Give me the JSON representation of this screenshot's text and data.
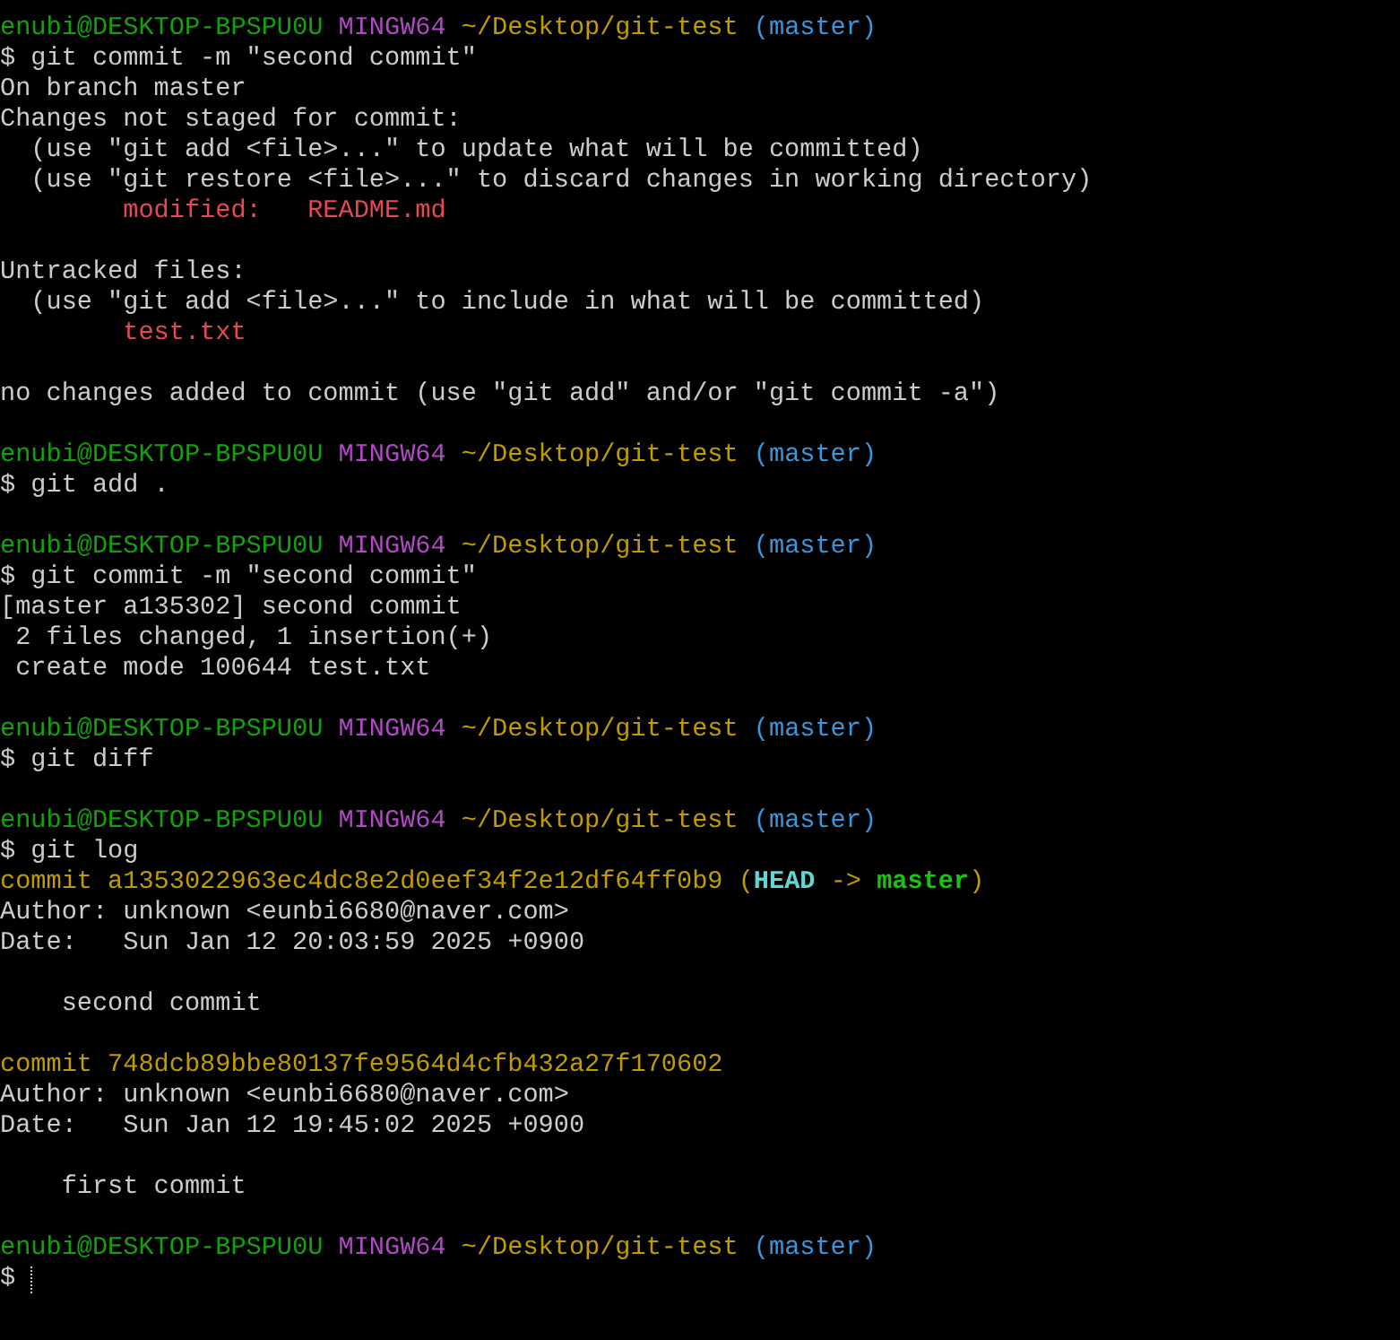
{
  "blocks": [
    {
      "lines": [
        {
          "segments": [
            {
              "text": "enubi@DESKTOP-BPSPU0U",
              "color": "#13a10e"
            },
            {
              "text": " MINGW64",
              "color": "#b148c6"
            },
            {
              "text": " ~/Desktop/git-test",
              "color": "#c19c00"
            },
            {
              "text": " (master)",
              "color": "#3a96dd"
            }
          ]
        },
        {
          "segments": [
            {
              "text": "$ git commit -m \"second commit\"",
              "color": "#cccccc"
            }
          ]
        },
        {
          "segments": [
            {
              "text": "On branch master",
              "color": "#cccccc"
            }
          ]
        },
        {
          "segments": [
            {
              "text": "Changes not staged for commit:",
              "color": "#cccccc"
            }
          ]
        },
        {
          "segments": [
            {
              "text": "  (use \"git add <file>...\" to update what will be committed)",
              "color": "#cccccc"
            }
          ]
        },
        {
          "segments": [
            {
              "text": "  (use \"git restore <file>...\" to discard changes in working directory)",
              "color": "#cccccc"
            }
          ]
        },
        {
          "segments": [
            {
              "text": "        modified:   README.md",
              "color": "#e74856"
            }
          ]
        }
      ]
    },
    {
      "lines": [
        {
          "segments": [
            {
              "text": "Untracked files:",
              "color": "#cccccc"
            }
          ]
        },
        {
          "segments": [
            {
              "text": "  (use \"git add <file>...\" to include in what will be committed)",
              "color": "#cccccc"
            }
          ]
        },
        {
          "segments": [
            {
              "text": "        test.txt",
              "color": "#e74856"
            }
          ]
        }
      ]
    },
    {
      "lines": [
        {
          "segments": [
            {
              "text": "no changes added to commit (use \"git add\" and/or \"git commit -a\")",
              "color": "#cccccc"
            }
          ]
        }
      ]
    },
    {
      "lines": [
        {
          "segments": [
            {
              "text": "enubi@DESKTOP-BPSPU0U",
              "color": "#13a10e"
            },
            {
              "text": " MINGW64",
              "color": "#b148c6"
            },
            {
              "text": " ~/Desktop/git-test",
              "color": "#c19c00"
            },
            {
              "text": " (master)",
              "color": "#3a96dd"
            }
          ]
        },
        {
          "segments": [
            {
              "text": "$ git add .",
              "color": "#cccccc"
            }
          ]
        }
      ]
    },
    {
      "lines": [
        {
          "segments": [
            {
              "text": "enubi@DESKTOP-BPSPU0U",
              "color": "#13a10e"
            },
            {
              "text": " MINGW64",
              "color": "#b148c6"
            },
            {
              "text": " ~/Desktop/git-test",
              "color": "#c19c00"
            },
            {
              "text": " (master)",
              "color": "#3a96dd"
            }
          ]
        },
        {
          "segments": [
            {
              "text": "$ git commit -m \"second commit\"",
              "color": "#cccccc"
            }
          ]
        },
        {
          "segments": [
            {
              "text": "[master a135302] second commit",
              "color": "#cccccc"
            }
          ]
        },
        {
          "segments": [
            {
              "text": " 2 files changed, 1 insertion(+)",
              "color": "#cccccc"
            }
          ]
        },
        {
          "segments": [
            {
              "text": " create mode 100644 test.txt",
              "color": "#cccccc"
            }
          ]
        }
      ]
    },
    {
      "lines": [
        {
          "segments": [
            {
              "text": "enubi@DESKTOP-BPSPU0U",
              "color": "#13a10e"
            },
            {
              "text": " MINGW64",
              "color": "#b148c6"
            },
            {
              "text": " ~/Desktop/git-test",
              "color": "#c19c00"
            },
            {
              "text": " (master)",
              "color": "#3a96dd"
            }
          ]
        },
        {
          "segments": [
            {
              "text": "$ git diff",
              "color": "#cccccc"
            }
          ]
        }
      ]
    },
    {
      "lines": [
        {
          "segments": [
            {
              "text": "enubi@DESKTOP-BPSPU0U",
              "color": "#13a10e"
            },
            {
              "text": " MINGW64",
              "color": "#b148c6"
            },
            {
              "text": " ~/Desktop/git-test",
              "color": "#c19c00"
            },
            {
              "text": " (master)",
              "color": "#3a96dd"
            }
          ]
        },
        {
          "segments": [
            {
              "text": "$ git log",
              "color": "#cccccc"
            }
          ]
        },
        {
          "segments": [
            {
              "text": "commit a1353022963ec4dc8e2d0eef34f2e12df64ff0b9",
              "color": "#c19c00",
              "bold": false
            },
            {
              "text": " (",
              "color": "#c19c00",
              "bold": false
            },
            {
              "text": "HEAD",
              "color": "#61d6d6",
              "bold": true
            },
            {
              "text": " ->",
              "color": "#c19c00",
              "bold": false
            },
            {
              "text": " master",
              "color": "#16c60c",
              "bold": true
            },
            {
              "text": ")",
              "color": "#c19c00",
              "bold": false
            }
          ]
        },
        {
          "segments": [
            {
              "text": "Author: unknown <eunbi6680@naver.com>",
              "color": "#cccccc"
            }
          ]
        },
        {
          "segments": [
            {
              "text": "Date:   Sun Jan 12 20:03:59 2025 +0900",
              "color": "#cccccc"
            }
          ]
        }
      ]
    },
    {
      "lines": [
        {
          "segments": [
            {
              "text": "    second commit",
              "color": "#cccccc"
            }
          ]
        }
      ]
    },
    {
      "lines": [
        {
          "segments": [
            {
              "text": "commit 748dcb89bbe80137fe9564d4cfb432a27f170602",
              "color": "#c19c00"
            }
          ]
        },
        {
          "segments": [
            {
              "text": "Author: unknown <eunbi6680@naver.com>",
              "color": "#cccccc"
            }
          ]
        },
        {
          "segments": [
            {
              "text": "Date:   Sun Jan 12 19:45:02 2025 +0900",
              "color": "#cccccc"
            }
          ]
        }
      ]
    },
    {
      "lines": [
        {
          "segments": [
            {
              "text": "    first commit",
              "color": "#cccccc"
            }
          ]
        }
      ]
    },
    {
      "lines": [
        {
          "segments": [
            {
              "text": "enubi@DESKTOP-BPSPU0U",
              "color": "#13a10e"
            },
            {
              "text": " MINGW64",
              "color": "#b148c6"
            },
            {
              "text": " ~/Desktop/git-test",
              "color": "#c19c00"
            },
            {
              "text": " (master)",
              "color": "#3a96dd"
            }
          ]
        }
      ]
    }
  ],
  "input_line": {
    "prompt": "$",
    "cursor": true
  }
}
